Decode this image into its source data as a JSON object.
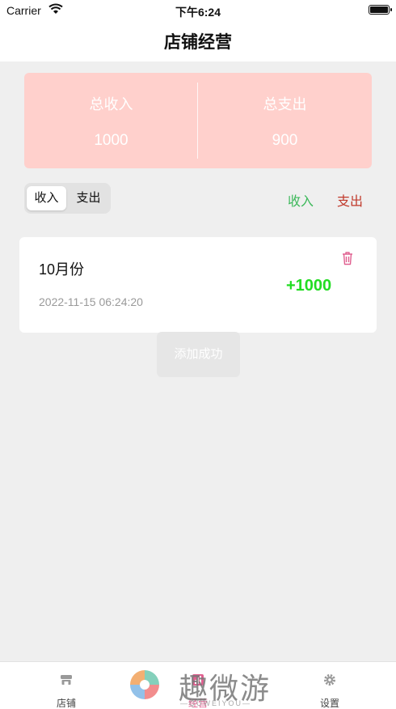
{
  "status": {
    "carrier": "Carrier",
    "time": "下午6:24"
  },
  "nav": {
    "title": "店铺经营"
  },
  "summary": {
    "income_label": "总收入",
    "income_value": "1000",
    "expense_label": "总支出",
    "expense_value": "900"
  },
  "segment": {
    "income": "收入",
    "expense": "支出",
    "selected": "收入"
  },
  "links": {
    "income": "收入",
    "expense": "支出"
  },
  "records": [
    {
      "title": "10月份",
      "date": "2022-11-15 06:24:20",
      "amount": "+1000"
    }
  ],
  "toast": {
    "text": "添加成功"
  },
  "tabs": [
    {
      "label": "店铺",
      "icon": "store-icon"
    },
    {
      "label": "经营",
      "icon": "chart-icon",
      "active": true
    },
    {
      "label": "设置",
      "icon": "gear-icon"
    }
  ],
  "watermark": {
    "title": "趣微游",
    "sub": "—QUWEIYOU—"
  },
  "colors": {
    "summary_bg": "#ffd0cc",
    "income_green": "#3cb85a",
    "expense_red": "#c0392b",
    "amount_green": "#22dd22",
    "tab_active": "#e06090"
  }
}
